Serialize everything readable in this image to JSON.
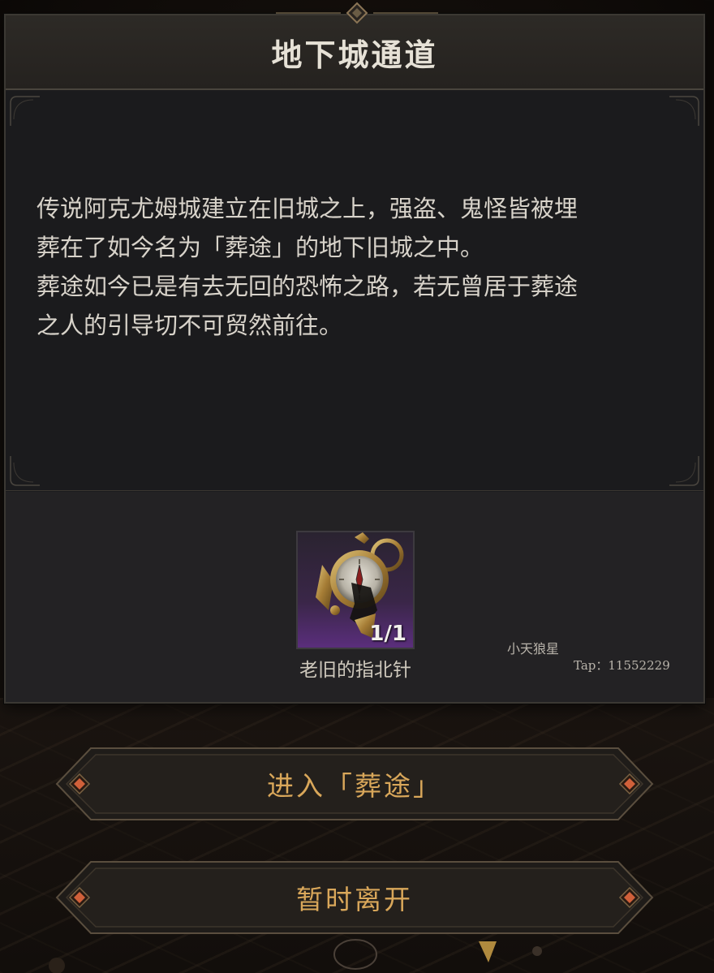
{
  "dialog": {
    "title": "地下城通道",
    "description_lines": [
      "传说阿克尤姆城建立在旧城之上，强盗、鬼怪皆被埋",
      "葬在了如今名为「葬途」的地下旧城之中。",
      "葬途如今已是有去无回的恐怖之路，若无曾居于葬途",
      "之人的引导切不可贸然前往。"
    ]
  },
  "required_item": {
    "name": "老旧的指北针",
    "count": "1/1",
    "icon": "old-compass-icon"
  },
  "watermark": {
    "name": "小天狼星",
    "tap": "Tap：11552229"
  },
  "buttons": {
    "enter_label": "进入「葬途」",
    "leave_label": "暂时离开"
  },
  "colors": {
    "panel_bg": "#1c1c1e",
    "button_text": "#d9a75a",
    "item_rarity": "#5a2e7c"
  }
}
